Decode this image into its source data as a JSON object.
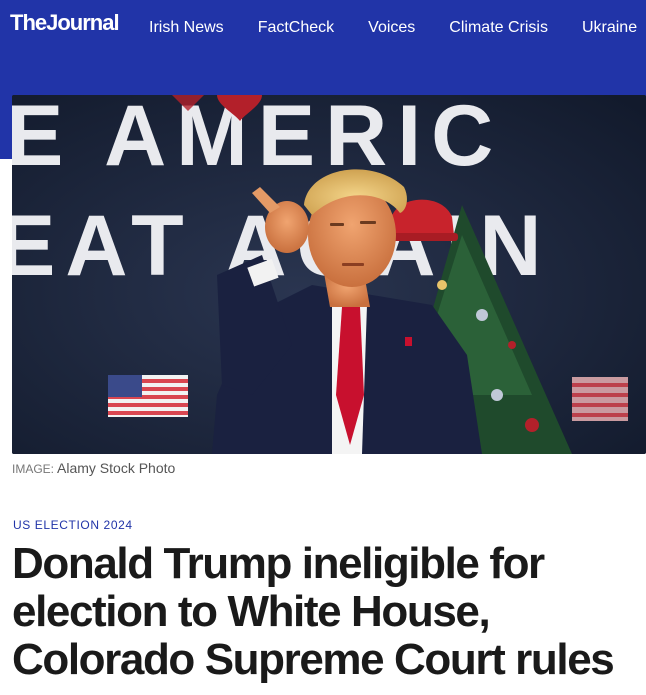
{
  "header": {
    "logo": "TheJournal",
    "nav": [
      {
        "label": "Irish News"
      },
      {
        "label": "FactCheck"
      },
      {
        "label": "Voices"
      },
      {
        "label": "Climate Crisis"
      },
      {
        "label": "Ukraine"
      }
    ],
    "background_color": "#2134a8"
  },
  "hero": {
    "banner_text_line1": "E AMERIC",
    "banner_text_line2": "EAT AGAIN",
    "caption_label": "IMAGE:",
    "caption_text": "Alamy Stock Photo"
  },
  "article": {
    "kicker": "US ELECTION 2024",
    "headline": "Donald Trump ineligible for election to White House, Colorado Supreme Court rules"
  },
  "colors": {
    "accent": "#2134a8",
    "headline": "#1a1a1a"
  }
}
